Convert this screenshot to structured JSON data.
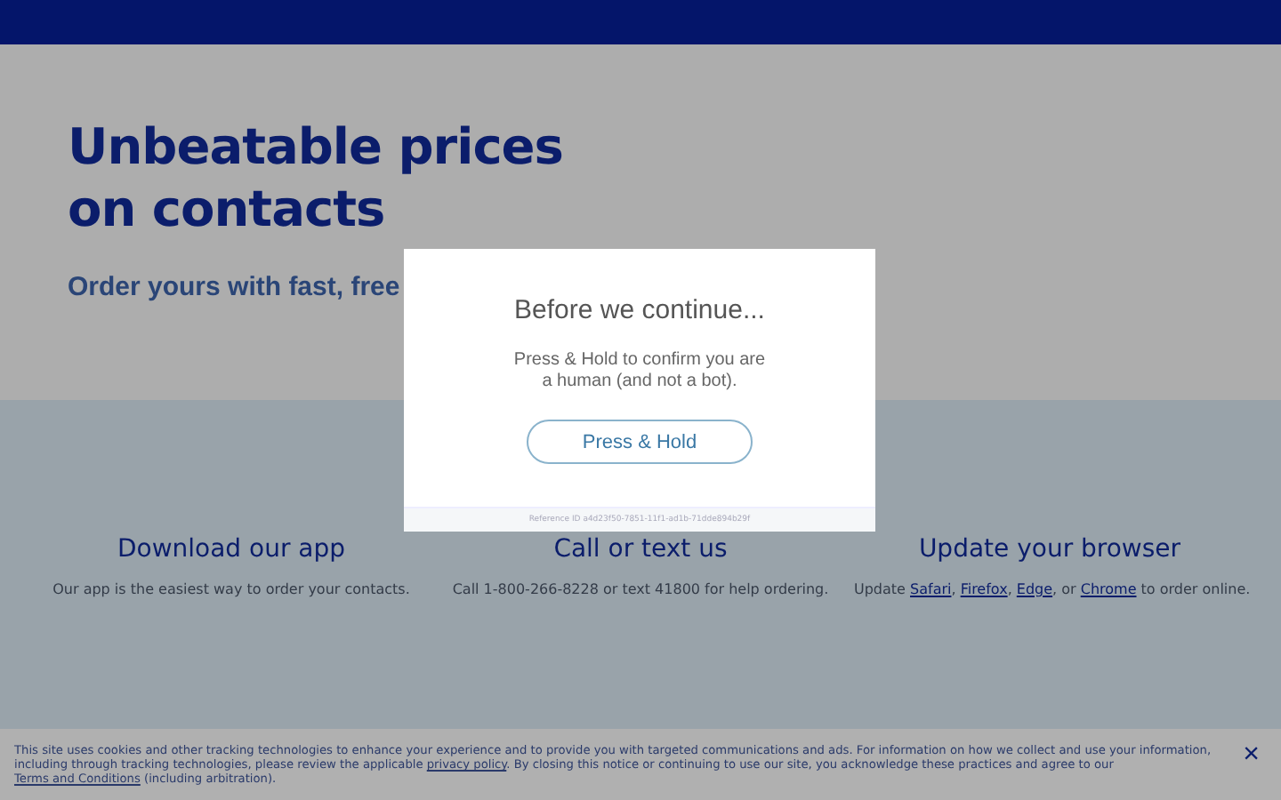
{
  "hero": {
    "title_lines": [
      "Unbeatable prices",
      "on contacts"
    ],
    "subtitle": "Order yours with fast, free"
  },
  "features": [
    {
      "heading": "Download our app",
      "text": [
        {
          "kind": "text",
          "value": "Our app is the easiest way to order your contacts."
        }
      ]
    },
    {
      "heading": "Call or text us",
      "text": [
        {
          "kind": "text",
          "value": "Call 1-800-266-8228 or text 41800 for help ordering."
        }
      ]
    },
    {
      "heading": "Update your browser",
      "text": [
        {
          "kind": "text",
          "value": "Update "
        },
        {
          "kind": "link",
          "value": "Safari"
        },
        {
          "kind": "text",
          "value": ", "
        },
        {
          "kind": "link",
          "value": "Firefox"
        },
        {
          "kind": "text",
          "value": ", "
        },
        {
          "kind": "link",
          "value": "Edge"
        },
        {
          "kind": "text",
          "value": ", or "
        },
        {
          "kind": "link",
          "value": "Chrome"
        },
        {
          "kind": "text",
          "value": " to order online."
        }
      ]
    }
  ],
  "dialog": {
    "title": "Before we continue...",
    "message_lines": [
      "Press & Hold to confirm you are",
      "a human (and not a bot)."
    ],
    "button": "Press & Hold",
    "reference": "Reference ID a4d23f50-7851-11f1-ad1b-71dde894b29f"
  },
  "cookie_notice": {
    "text": [
      {
        "kind": "text",
        "value": "This site uses cookies and other tracking technologies to enhance your experience and to provide you with targeted communications and ads. For information on how we collect and use your information, including through tracking technologies, please review the applicable "
      },
      {
        "kind": "link",
        "value": "privacy policy"
      },
      {
        "kind": "text",
        "value": ". By closing this notice or continuing to use our site, you acknowledge these practices and agree to our "
      },
      {
        "kind": "link",
        "value": "Terms and Conditions"
      },
      {
        "kind": "text",
        "value": " (including arbitration)."
      }
    ],
    "close": "×"
  }
}
